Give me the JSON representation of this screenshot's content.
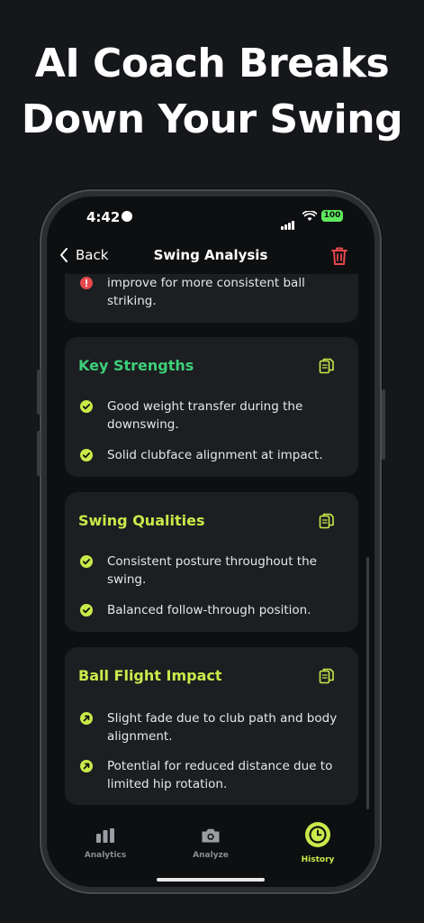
{
  "headline": {
    "line1": "AI Coach Breaks",
    "line2": "Down Your Swing"
  },
  "status_bar": {
    "time": "4:42",
    "battery": "100"
  },
  "nav": {
    "back_label": "Back",
    "title": "Swing Analysis"
  },
  "colors": {
    "accent": "#c8ea4a",
    "strengths_title": "#3ecf7a",
    "error": "#e5484d",
    "trash": "#e5484d",
    "card_bg": "#1c1e21",
    "screen_bg": "#0e0f11"
  },
  "partial_card": {
    "items": [
      {
        "icon": "alert-circle-icon",
        "text": "improve for more consistent ball striking."
      }
    ]
  },
  "cards": [
    {
      "title": "Key Strengths",
      "icon": "check-circle-icon",
      "items": [
        "Good weight transfer during the downswing.",
        "Solid clubface alignment at impact."
      ]
    },
    {
      "title": "Swing Qualities",
      "icon": "check-circle-icon",
      "items": [
        "Consistent posture throughout the swing.",
        "Balanced follow-through position."
      ]
    },
    {
      "title": "Ball Flight Impact",
      "icon": "arrow-up-right-icon",
      "items": [
        "Slight fade due to club path and body alignment.",
        "Potential for reduced distance due to limited hip rotation."
      ]
    }
  ],
  "tabs": [
    {
      "label": "Analytics",
      "icon": "bar-chart-icon",
      "active": false
    },
    {
      "label": "Analyze",
      "icon": "camera-icon",
      "active": false
    },
    {
      "label": "History",
      "icon": "clock-icon",
      "active": true
    }
  ]
}
